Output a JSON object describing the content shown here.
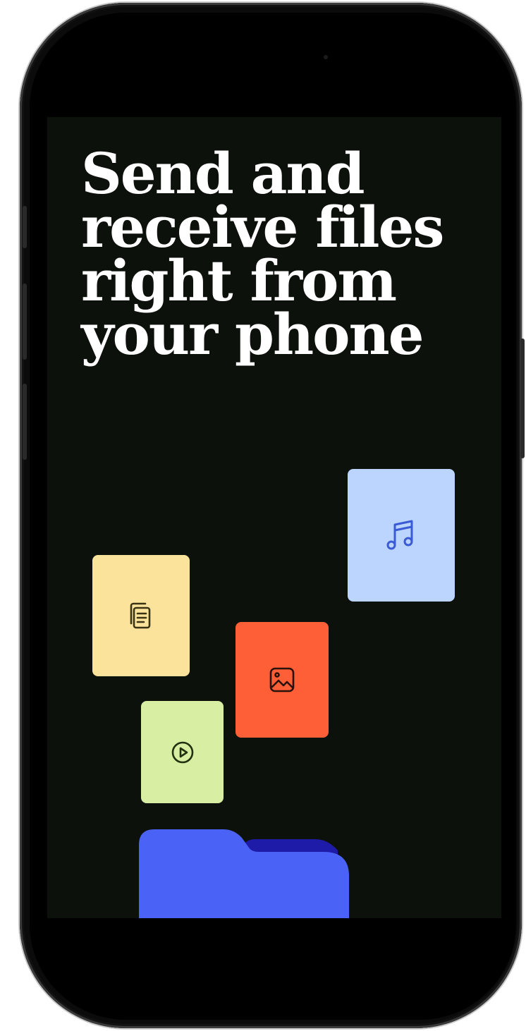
{
  "headline": {
    "line1": "Send and",
    "line2": "receive files",
    "line3": "right from",
    "line4": "your phone"
  },
  "colors": {
    "screen_bg": "#0d110c",
    "music_card": "#bcd5ff",
    "document_card": "#fbe39b",
    "image_card": "#ff5f37",
    "video_card": "#d8eea2",
    "folder_front": "#4a62f5",
    "folder_back": "#1e1ba8"
  },
  "icons": [
    "music-icon",
    "document-icon",
    "image-icon",
    "video-icon",
    "folder-icon"
  ]
}
